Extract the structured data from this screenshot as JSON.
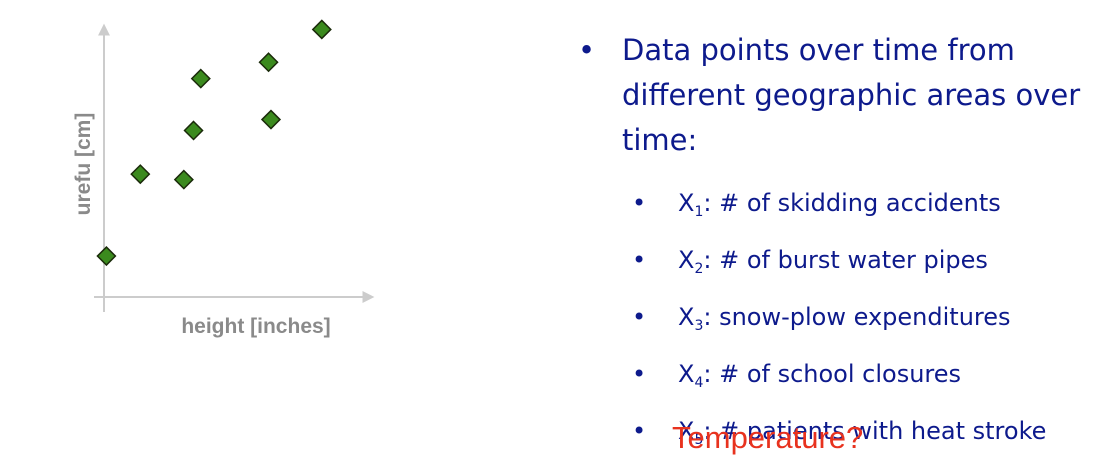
{
  "chart_data": {
    "type": "scatter",
    "xlabel": "height [inches]",
    "ylabel": "urefu [cm]",
    "xlim": [
      0,
      10
    ],
    "ylim": [
      0,
      10
    ],
    "grid": false,
    "points": [
      {
        "x": 0.1,
        "y": 1.5
      },
      {
        "x": 1.5,
        "y": 4.5
      },
      {
        "x": 3.3,
        "y": 4.3
      },
      {
        "x": 3.7,
        "y": 6.1
      },
      {
        "x": 4.0,
        "y": 8.0
      },
      {
        "x": 6.9,
        "y": 6.5
      },
      {
        "x": 6.8,
        "y": 8.6
      },
      {
        "x": 9.0,
        "y": 9.8
      }
    ],
    "marker_color": "#3b8a1e",
    "marker_stroke": "#1a2a0a",
    "axis_color": "#cccccc",
    "label_color": "#8a8a8a"
  },
  "bullets": {
    "main_text": "Data points over time from different geographic areas over time:",
    "items": [
      {
        "prefix": "X",
        "sub": "1",
        "text": ": # of skidding accidents"
      },
      {
        "prefix": "X",
        "sub": "2",
        "text": ": # of burst water pipes"
      },
      {
        "prefix": "X",
        "sub": "3",
        "text": ": snow-plow expenditures"
      },
      {
        "prefix": "X",
        "sub": "4",
        "text": ": # of school closures"
      },
      {
        "prefix": "X",
        "sub": "5",
        "text": ": # patients with heat stroke"
      }
    ],
    "text_color": "#0d1a8c"
  },
  "question": "Temperature?",
  "question_color": "#e8321e"
}
